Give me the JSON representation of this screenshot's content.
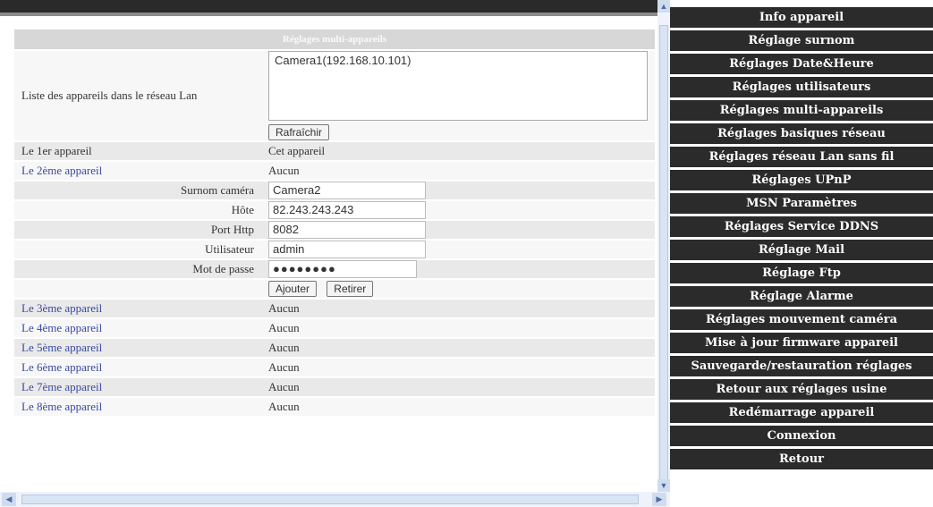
{
  "section_title": "Réglages multi-appareils",
  "lan_list_label": "Liste des appareils dans le réseau Lan",
  "lan_devices": [
    "Camera1(192.168.10.101)"
  ],
  "refresh_label": "Rafraîchir",
  "device1": {
    "label": "Le 1er appareil",
    "value": "Cet appareil"
  },
  "device2": {
    "label": "Le 2ème appareil",
    "value": "Aucun",
    "fields": {
      "alias_label": "Surnom caméra",
      "alias_value": "Camera2",
      "host_label": "Hôte",
      "host_value": "82.243.243.243",
      "port_label": "Port Http",
      "port_value": "8082",
      "user_label": "Utilisateur",
      "user_value": "admin",
      "pass_label": "Mot de passe",
      "pass_value": "●●●●●●●●"
    },
    "add_label": "Ajouter",
    "remove_label": "Retirer"
  },
  "devices": [
    {
      "label": "Le 3ème appareil",
      "value": "Aucun"
    },
    {
      "label": "Le 4ème appareil",
      "value": "Aucun"
    },
    {
      "label": "Le 5ème appareil",
      "value": "Aucun"
    },
    {
      "label": "Le 6ème appareil",
      "value": "Aucun"
    },
    {
      "label": "Le 7ème appareil",
      "value": "Aucun"
    },
    {
      "label": "Le 8ème appareil",
      "value": "Aucun"
    }
  ],
  "menu": [
    "Info appareil",
    "Réglage surnom",
    "Réglages Date&Heure",
    "Réglages utilisateurs",
    "Réglages multi-appareils",
    "Réglages basiques réseau",
    "Réglages réseau Lan sans fil",
    "Réglages UPnP",
    "MSN Paramètres",
    "Réglages Service DDNS",
    "Réglage Mail",
    "Réglage Ftp",
    "Réglage Alarme",
    "Réglages mouvement caméra",
    "Mise à jour firmware appareil",
    "Sauvegarde/restauration réglages",
    "Retour aux réglages usine",
    "Redémarrage appareil",
    "Connexion",
    "Retour"
  ],
  "icons": {
    "scroll_up": "▲",
    "scroll_down": "▼",
    "scroll_left": "◀",
    "scroll_right": "▶"
  },
  "colors": {
    "menu_bg": "#2b2b2b",
    "link": "#3a4aa0"
  }
}
